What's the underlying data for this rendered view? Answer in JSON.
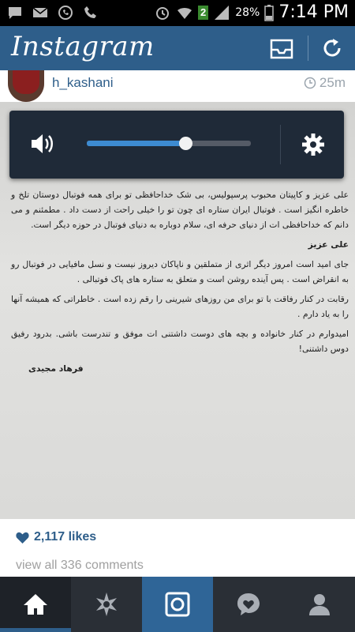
{
  "status_bar": {
    "battery": "28%",
    "time": "7:14 PM",
    "badge": "2",
    "icons": [
      "chat-icon",
      "mail-icon",
      "whatsapp-icon",
      "phone-icon",
      "alarm-icon",
      "wifi-icon",
      "signal-icon",
      "battery-icon"
    ]
  },
  "app": {
    "title": "Instagram",
    "accent": "#2e5e8a"
  },
  "post": {
    "username": "h_kashani",
    "time_ago": "25m",
    "letter": {
      "para1": "علی عزیز و کاپیتان محبوب پرسپولیس، بی شک خداحافظی تو برای همه فوتبال دوستان تلخ و خاطره انگیز است . فوتبال ایران ستاره ای چون تو را خیلی راحت از دست داد . مطمئنم و می دانم که خداحافظی ات از دنیای حرفه ای، سلام دوباره به دنیای فوتبال در حوزه دیگر است.",
      "heading": "علی عزیز",
      "para2": "جای امید است امروز دیگر اثری از متملقین و ناپاکان دیروز نیست و نسل مافیایی در فوتبال رو به انقراض است . پس آینده روشن است و متعلق به ستاره های پاک فوتبالی .",
      "para3": "رقابت در کنار رفاقت با تو برای من روزهای شیرینی را رقم زده است . خاطراتی که همیشه آنها را به یاد دارم .",
      "para4": "امیدوارم در کنار خانواده و بچه های دوست داشتنی ات موفق و تندرست باشی. بدرود رفیق دوس داشتنی!",
      "signature": "فرهاد مجیدی"
    },
    "likes": "2,117 likes",
    "comments_link": "view all 336 comments"
  },
  "volume": {
    "level": 0.6
  },
  "nav": {
    "items": [
      "home",
      "explore",
      "camera",
      "activity",
      "profile"
    ],
    "active": "home"
  }
}
